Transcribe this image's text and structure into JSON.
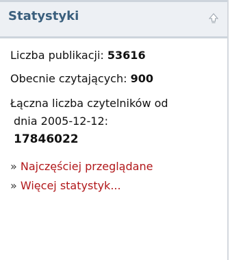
{
  "header": {
    "title": "Statystyki",
    "icon": "collapse-arrow-icon"
  },
  "stats": {
    "publications_label": "Liczba publikacji:",
    "publications_value": "53616",
    "readers_now_label": "Obecnie czytających:",
    "readers_now_value": "900",
    "total_readers_label_line1": "Łączna liczba czytelników od",
    "total_readers_label_line2": "dnia 2005-12-12:",
    "total_readers_value": "17846022"
  },
  "links": [
    {
      "prefix": "»",
      "label": "Najczęściej przeglądane"
    },
    {
      "prefix": "»",
      "label": "Więcej statystyk..."
    }
  ],
  "colors": {
    "header_bg": "#edf0f4",
    "header_title": "#3a5f7d",
    "link": "#b1171a"
  }
}
